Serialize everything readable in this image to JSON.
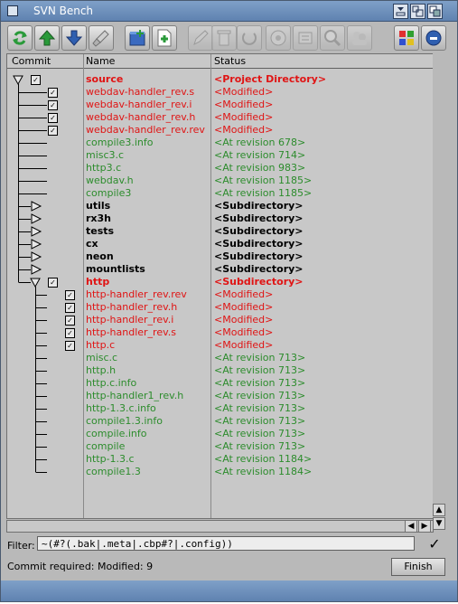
{
  "window": {
    "title": "SVN Bench"
  },
  "header": {
    "commit": "Commit",
    "name": "Name",
    "status": "Status"
  },
  "rows": [
    {
      "name": "source",
      "status": "<Project Directory>",
      "cls": "red bold",
      "depth": 0,
      "expander": "open",
      "checked": true
    },
    {
      "name": "webdav-handler_rev.s",
      "status": "<Modified>",
      "cls": "red",
      "depth": 1,
      "checked": true
    },
    {
      "name": "webdav-handler_rev.i",
      "status": "<Modified>",
      "cls": "red",
      "depth": 1,
      "checked": true
    },
    {
      "name": "webdav-handler_rev.h",
      "status": "<Modified>",
      "cls": "red",
      "depth": 1,
      "checked": true
    },
    {
      "name": "webdav-handler_rev.rev",
      "status": "<Modified>",
      "cls": "red",
      "depth": 1,
      "checked": true
    },
    {
      "name": "compile3.info",
      "status": "<At revision 678>",
      "cls": "green",
      "depth": 1
    },
    {
      "name": "misc3.c",
      "status": "<At revision 714>",
      "cls": "green",
      "depth": 1
    },
    {
      "name": "http3.c",
      "status": "<At revision 983>",
      "cls": "green",
      "depth": 1
    },
    {
      "name": "webdav.h",
      "status": "<At revision 1185>",
      "cls": "green",
      "depth": 1
    },
    {
      "name": "compile3",
      "status": "<At revision 1185>",
      "cls": "green",
      "depth": 1
    },
    {
      "name": "utils",
      "status": "<Subdirectory>",
      "cls": "blk bold",
      "depth": 1,
      "expander": "closed"
    },
    {
      "name": "rx3h",
      "status": "<Subdirectory>",
      "cls": "blk bold",
      "depth": 1,
      "expander": "closed"
    },
    {
      "name": "tests",
      "status": "<Subdirectory>",
      "cls": "blk bold",
      "depth": 1,
      "expander": "closed"
    },
    {
      "name": "cx",
      "status": "<Subdirectory>",
      "cls": "blk bold",
      "depth": 1,
      "expander": "closed"
    },
    {
      "name": "neon",
      "status": "<Subdirectory>",
      "cls": "blk bold",
      "depth": 1,
      "expander": "closed"
    },
    {
      "name": "mountlists",
      "status": "<Subdirectory>",
      "cls": "blk bold",
      "depth": 1,
      "expander": "closed"
    },
    {
      "name": "http",
      "status": "<Subdirectory>",
      "cls": "red bold",
      "depth": 1,
      "expander": "open",
      "checked": true
    },
    {
      "name": "http-handler_rev.rev",
      "status": "<Modified>",
      "cls": "red",
      "depth": 2,
      "checked": true
    },
    {
      "name": "http-handler_rev.h",
      "status": "<Modified>",
      "cls": "red",
      "depth": 2,
      "checked": true
    },
    {
      "name": "http-handler_rev.i",
      "status": "<Modified>",
      "cls": "red",
      "depth": 2,
      "checked": true
    },
    {
      "name": "http-handler_rev.s",
      "status": "<Modified>",
      "cls": "red",
      "depth": 2,
      "checked": true
    },
    {
      "name": "http.c",
      "status": "<Modified>",
      "cls": "red",
      "depth": 2,
      "checked": true
    },
    {
      "name": "misc.c",
      "status": "<At revision 713>",
      "cls": "green",
      "depth": 2
    },
    {
      "name": "http.h",
      "status": "<At revision 713>",
      "cls": "green",
      "depth": 2
    },
    {
      "name": "http.c.info",
      "status": "<At revision 713>",
      "cls": "green",
      "depth": 2
    },
    {
      "name": "http-handler1_rev.h",
      "status": "<At revision 713>",
      "cls": "green",
      "depth": 2
    },
    {
      "name": "http-1.3.c.info",
      "status": "<At revision 713>",
      "cls": "green",
      "depth": 2
    },
    {
      "name": "compile1.3.info",
      "status": "<At revision 713>",
      "cls": "green",
      "depth": 2
    },
    {
      "name": "compile.info",
      "status": "<At revision 713>",
      "cls": "green",
      "depth": 2
    },
    {
      "name": "compile",
      "status": "<At revision 713>",
      "cls": "green",
      "depth": 2
    },
    {
      "name": "http-1.3.c",
      "status": "<At revision 1184>",
      "cls": "green",
      "depth": 2
    },
    {
      "name": "compile1.3",
      "status": "<At revision 1184>",
      "cls": "green",
      "depth": 2
    }
  ],
  "filter": {
    "label": "Filter:",
    "value": "~(#?(.bak|.meta|.cbp#?|.config))"
  },
  "statusbar": {
    "text": "Commit required: Modified: 9",
    "finish_label": "Finish"
  }
}
